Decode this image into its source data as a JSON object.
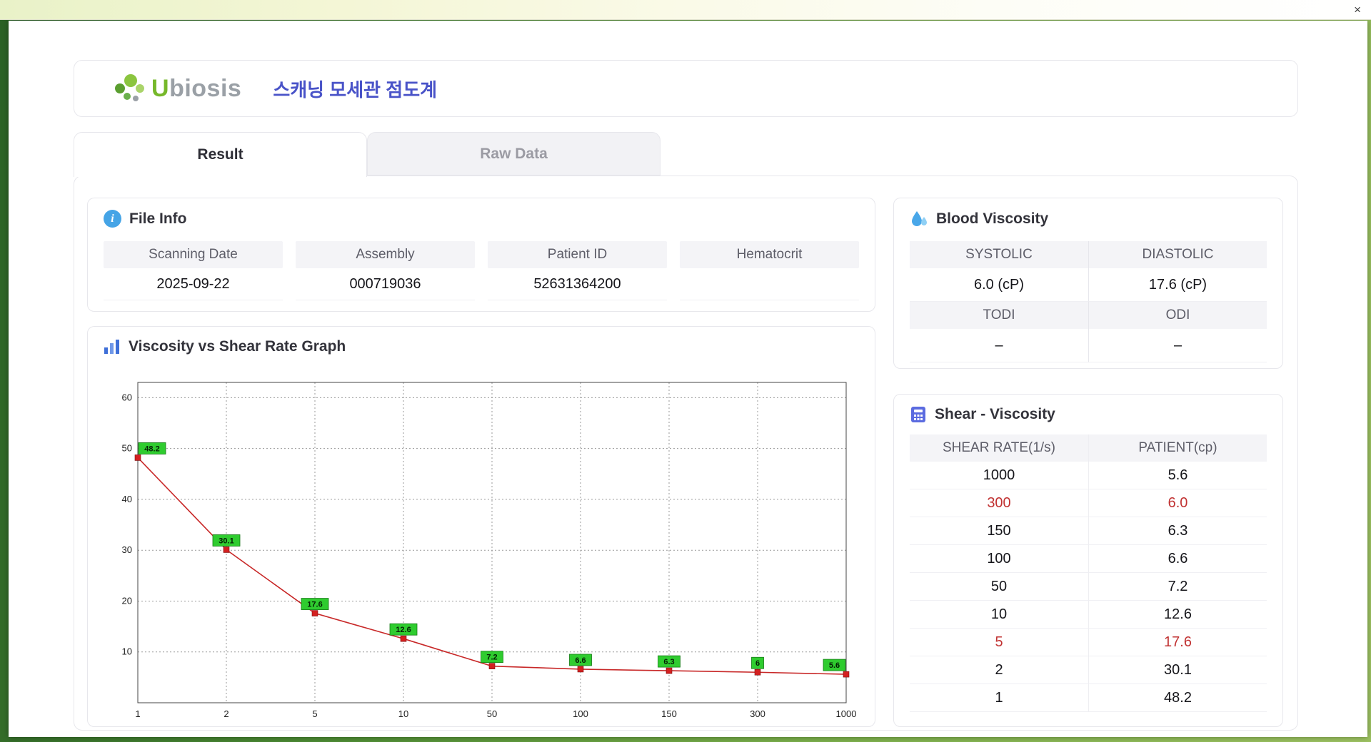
{
  "window": {
    "close_label": "×"
  },
  "header": {
    "logo_u": "U",
    "logo_rest": "biosis",
    "title": "스캐닝 모세관 점도계"
  },
  "tabs": [
    {
      "label": "Result",
      "active": true
    },
    {
      "label": "Raw Data",
      "active": false
    }
  ],
  "file_info": {
    "title": "File Info",
    "fields": [
      {
        "label": "Scanning Date",
        "value": "2025-09-22"
      },
      {
        "label": "Assembly",
        "value": "000719036"
      },
      {
        "label": "Patient ID",
        "value": "52631364200"
      },
      {
        "label": "Hematocrit",
        "value": ""
      }
    ]
  },
  "blood_viscosity": {
    "title": "Blood Viscosity",
    "cells": [
      {
        "label": "SYSTOLIC",
        "value": "6.0 (cP)"
      },
      {
        "label": "DIASTOLIC",
        "value": "17.6 (cP)"
      },
      {
        "label": "TODI",
        "value": "–"
      },
      {
        "label": "ODI",
        "value": "–"
      }
    ]
  },
  "graph": {
    "title": "Viscosity vs Shear Rate Graph"
  },
  "chart_data": {
    "type": "line",
    "title": "Viscosity vs Shear Rate Graph",
    "categories": [
      "1",
      "2",
      "5",
      "10",
      "50",
      "100",
      "150",
      "300",
      "1000"
    ],
    "values": [
      48.2,
      30.1,
      17.6,
      12.6,
      7.2,
      6.6,
      6.3,
      6,
      5.6
    ],
    "point_labels": [
      "48.2",
      "30.1",
      "17.6",
      "12.6",
      "7.2",
      "6.6",
      "6.3",
      "6",
      "5.6"
    ],
    "xlabel": "",
    "ylabel": "",
    "ylim": [
      0,
      63
    ],
    "yticks": [
      10,
      20,
      30,
      40,
      50,
      60
    ],
    "x_scale": "categorical",
    "grid": true,
    "legend": false,
    "line_color": "#c82828",
    "marker_color": "#d42020",
    "label_bg": "#2fcc2f"
  },
  "shear_table": {
    "title": "Shear - Viscosity",
    "columns": [
      "SHEAR RATE(1/s)",
      "PATIENT(cp)"
    ],
    "rows": [
      {
        "shear": "1000",
        "patient": "5.6",
        "highlight": false
      },
      {
        "shear": "300",
        "patient": "6.0",
        "highlight": true
      },
      {
        "shear": "150",
        "patient": "6.3",
        "highlight": false
      },
      {
        "shear": "100",
        "patient": "6.6",
        "highlight": false
      },
      {
        "shear": "50",
        "patient": "7.2",
        "highlight": false
      },
      {
        "shear": "10",
        "patient": "12.6",
        "highlight": false
      },
      {
        "shear": "5",
        "patient": "17.6",
        "highlight": true
      },
      {
        "shear": "2",
        "patient": "30.1",
        "highlight": false
      },
      {
        "shear": "1",
        "patient": "48.2",
        "highlight": false
      }
    ]
  },
  "colors": {
    "accent_title": "#4953c8",
    "highlight_red": "#c13232",
    "label_green": "#2fcc2f",
    "logo_green": "#76b82a"
  }
}
